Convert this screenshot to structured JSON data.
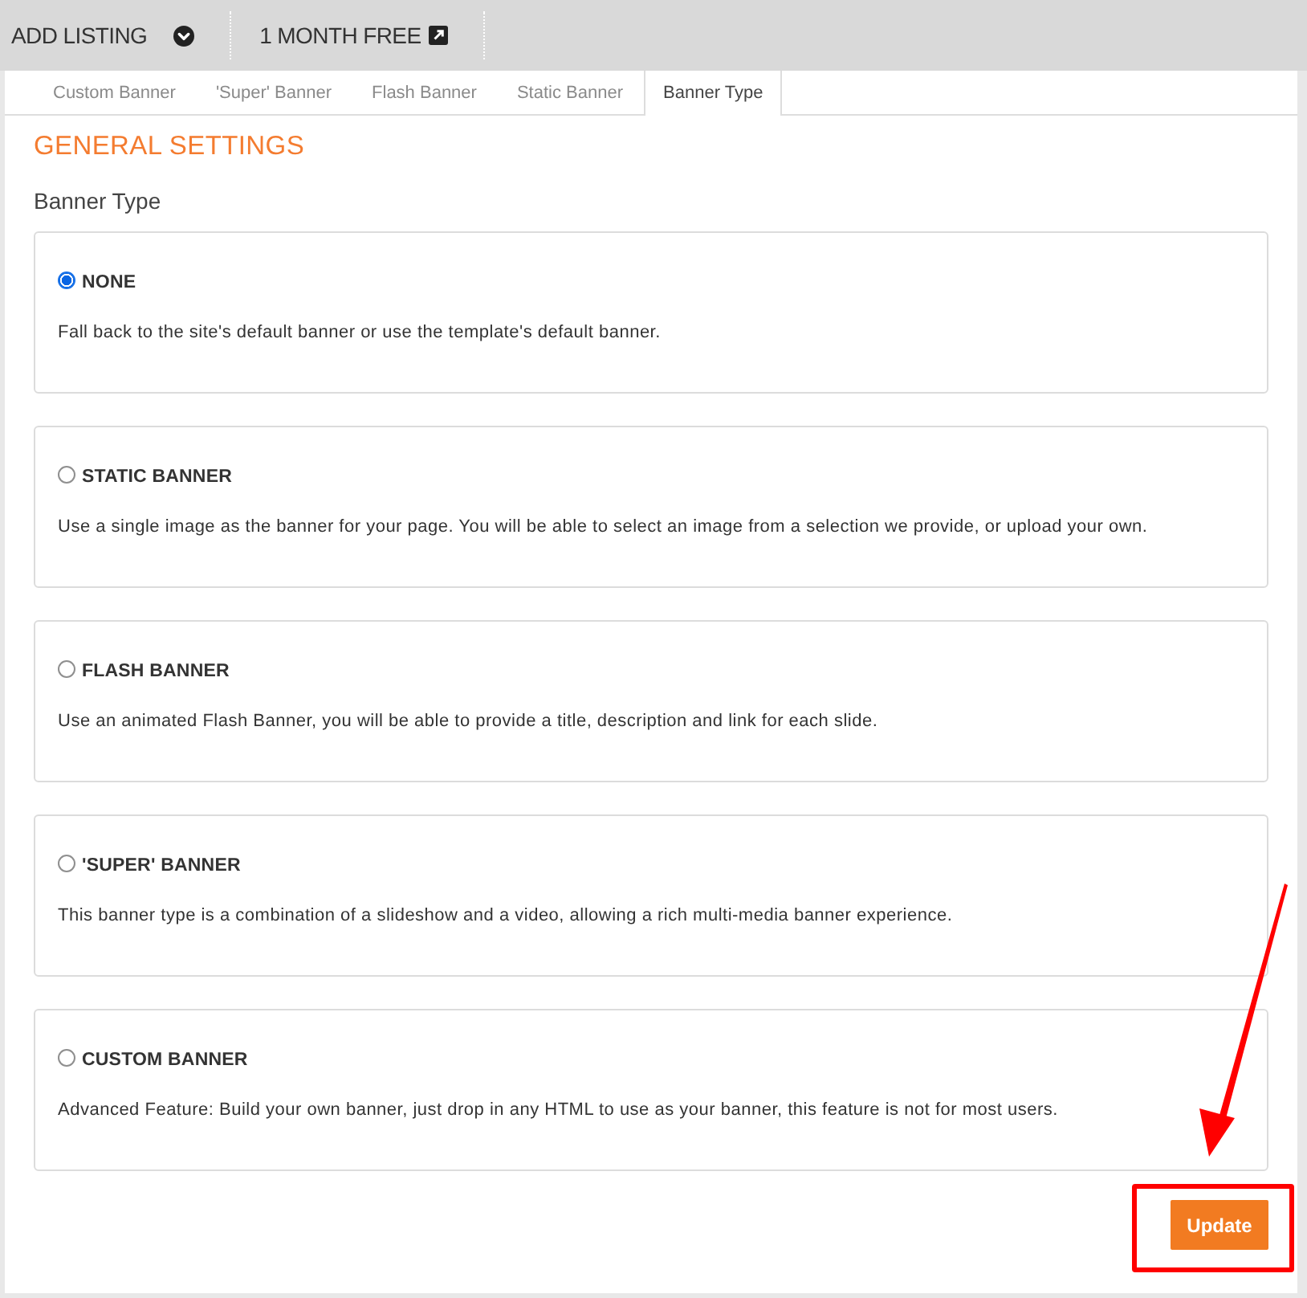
{
  "top_bar": {
    "items": [
      {
        "label": "ADD LISTING",
        "kind": "dropdown"
      },
      {
        "label": "1 MONTH FREE",
        "kind": "external"
      }
    ]
  },
  "tabs": [
    {
      "label": "Custom Banner",
      "selected": false
    },
    {
      "label": "'Super' Banner",
      "selected": false
    },
    {
      "label": "Flash Banner",
      "selected": false
    },
    {
      "label": "Static Banner",
      "selected": false
    },
    {
      "label": "Banner Type",
      "selected": true
    }
  ],
  "section_title": "GENERAL SETTINGS",
  "field_label": "Banner Type",
  "options": [
    {
      "title": "NONE",
      "description": "Fall back to the site's default banner or use the template's default banner.",
      "selected": true
    },
    {
      "title": "STATIC BANNER",
      "description": "Use a single image as the banner for your page. You will be able to select an image from a selection we provide, or upload your own.",
      "selected": false
    },
    {
      "title": "FLASH BANNER",
      "description": "Use an animated Flash Banner, you will be able to provide a title, description and link for each slide.",
      "selected": false
    },
    {
      "title": "'SUPER' BANNER",
      "description": "This banner type is a combination of a slideshow and a video, allowing a rich multi-media banner experience.",
      "selected": false
    },
    {
      "title": "CUSTOM BANNER",
      "description": "Advanced Feature: Build your own banner, just drop in any HTML to use as your banner, this feature is not for most users.",
      "selected": false
    }
  ],
  "update_button": "Update"
}
